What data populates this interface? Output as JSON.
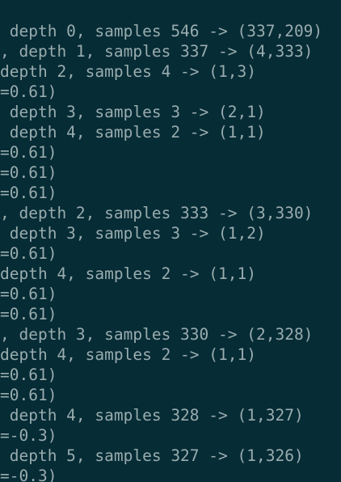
{
  "terminal": {
    "lines": [
      " depth 0, samples 546 -> (337,209)",
      ", depth 1, samples 337 -> (4,333)",
      "depth 2, samples 4 -> (1,3)",
      "=0.61)",
      " depth 3, samples 3 -> (2,1)",
      " depth 4, samples 2 -> (1,1)",
      "=0.61)",
      "=0.61)",
      "=0.61)",
      ", depth 2, samples 333 -> (3,330)",
      " depth 3, samples 3 -> (1,2)",
      "=0.61)",
      "depth 4, samples 2 -> (1,1)",
      "=0.61)",
      "=0.61)",
      ", depth 3, samples 330 -> (2,328)",
      "depth 4, samples 2 -> (1,1)",
      "=0.61)",
      "=0.61)",
      " depth 4, samples 328 -> (1,327)",
      "=-0.3)",
      " depth 5, samples 327 -> (1,326)",
      "=-0.3)"
    ]
  }
}
